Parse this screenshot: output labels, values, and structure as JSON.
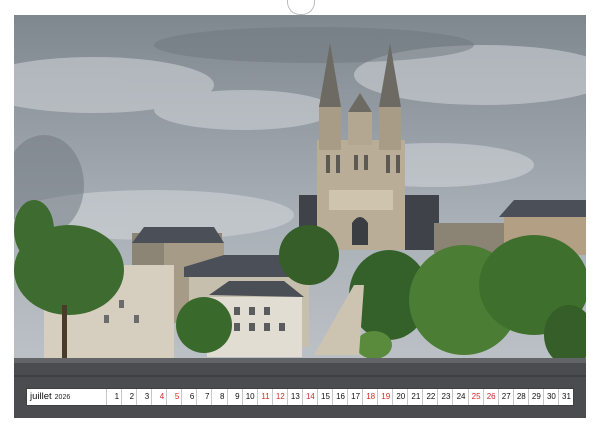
{
  "calendar": {
    "month": "juillet",
    "year": "2026",
    "days": [
      "1",
      "2",
      "3",
      "4",
      "5",
      "6",
      "7",
      "8",
      "9",
      "10",
      "11",
      "12",
      "13",
      "14",
      "15",
      "16",
      "17",
      "18",
      "19",
      "20",
      "21",
      "22",
      "23",
      "24",
      "25",
      "26",
      "27",
      "28",
      "29",
      "30",
      "31"
    ],
    "red_days": [
      "4",
      "5",
      "11",
      "12",
      "14",
      "18",
      "19",
      "25",
      "26"
    ]
  },
  "photo": {
    "subject": "cathedral-town-view",
    "colors": {
      "sky": "#9aa2aa",
      "cloud": "#c6cbd0",
      "stone": "#b9ad98",
      "roof": "#4b4f57",
      "foliage": "#3e6b2f",
      "wall": "#4a4c4f"
    }
  },
  "colors": {
    "weekend": "#d22b2b",
    "binding_hole": "#c9c9c9"
  }
}
